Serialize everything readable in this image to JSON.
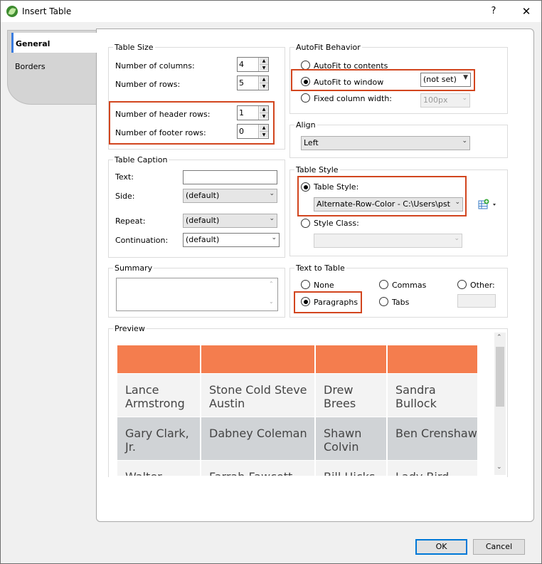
{
  "window": {
    "title": "Insert Table",
    "help": "?",
    "close": "✕"
  },
  "tabs": [
    {
      "label": "General"
    },
    {
      "label": "Borders"
    }
  ],
  "table_size": {
    "group_label": "Table Size",
    "columns_label": "Number of columns:",
    "columns_value": "4",
    "rows_label": "Number of rows:",
    "rows_value": "5",
    "header_rows_label": "Number of header rows:",
    "header_rows_value": "1",
    "footer_rows_label": "Number of footer rows:",
    "footer_rows_value": "0"
  },
  "autofit": {
    "group_label": "AutoFit Behavior",
    "contents_label": "AutoFit to contents",
    "window_label": "AutoFit to window",
    "window_select": "(not set)",
    "fixed_label": "Fixed column width:",
    "fixed_select": "100px",
    "selected": "window"
  },
  "align": {
    "group_label": "Align",
    "value": "Left"
  },
  "caption": {
    "group_label": "Table Caption",
    "text_label": "Text:",
    "text_value": "",
    "side_label": "Side:",
    "side_value": "(default)",
    "repeat_label": "Repeat:",
    "repeat_value": "(default)",
    "continuation_label": "Continuation:",
    "continuation_value": "(default)"
  },
  "table_style": {
    "group_label": "Table Style",
    "style_label": "Table Style:",
    "style_value": "Alternate-Row-Color - C:\\Users\\pstoec",
    "class_label": "Style Class:",
    "class_value": "",
    "selected": "style",
    "icon": "add-style-icon"
  },
  "summary": {
    "group_label": "Summary",
    "value": ""
  },
  "text_to_table": {
    "group_label": "Text to Table",
    "none_label": "None",
    "commas_label": "Commas",
    "other_label": "Other:",
    "paragraphs_label": "Paragraphs",
    "tabs_label": "Tabs",
    "other_value": "",
    "selected": "paragraphs"
  },
  "preview": {
    "group_label": "Preview",
    "header_color": "#f47d4e",
    "rows": [
      [
        "Lance Armstrong",
        "Stone Cold Steve Austin",
        "Drew Brees",
        "Sandra Bullock"
      ],
      [
        "Gary Clark, Jr.",
        "Dabney Coleman",
        "Shawn Colvin",
        "Ben Crenshaw"
      ],
      [
        "Walter",
        "Farrah Fawcett",
        "Bill Hicks",
        "Lady Bird"
      ]
    ],
    "row_colors": [
      "#f3f3f3",
      "#d0d3d6",
      "#f3f3f3"
    ]
  },
  "buttons": {
    "ok": "OK",
    "cancel": "Cancel"
  }
}
